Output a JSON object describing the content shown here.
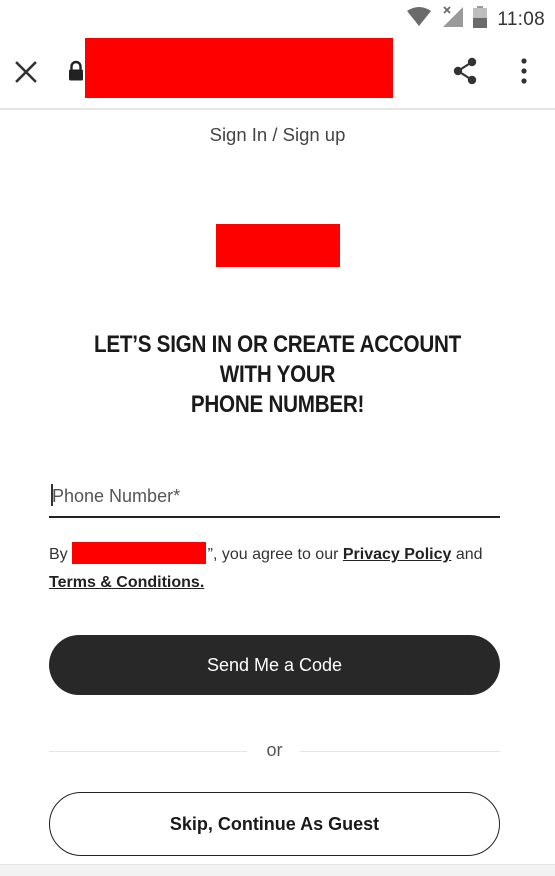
{
  "status_bar": {
    "time": "11:08",
    "icons": [
      "wifi-icon",
      "signal-icon",
      "battery-icon"
    ]
  },
  "browser_bar": {
    "close_icon": "close-icon",
    "lock_icon": "lock-icon",
    "share_icon": "share-icon",
    "menu_icon": "more-vert-icon"
  },
  "page": {
    "title": "Sign In / Sign up",
    "heading_line1": "LET’S SIGN IN OR CREATE ACCOUNT WITH YOUR",
    "heading_line2": "PHONE NUMBER!",
    "phone_placeholder": "Phone Number*",
    "phone_value": "",
    "consent_prefix": "By",
    "consent_middle": "”, you agree to our",
    "privacy_link": "Privacy Policy",
    "consent_and": "and",
    "terms_link": "Terms & Conditions.",
    "send_code_label": "Send Me a Code",
    "or_label": "or",
    "guest_label": "Skip, Continue As Guest"
  },
  "colors": {
    "primary_button": "#282828",
    "redaction": "#ff0000",
    "text": "#222222"
  }
}
